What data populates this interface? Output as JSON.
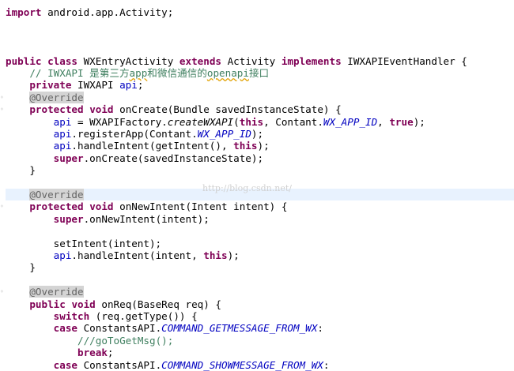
{
  "editor": {
    "lines": [
      [
        {
          "t": "import",
          "c": "kw"
        },
        {
          "t": " android.app.Activity;"
        }
      ],
      [],
      [],
      [],
      [
        {
          "t": "public",
          "c": "kw"
        },
        {
          "t": " "
        },
        {
          "t": "class",
          "c": "kw"
        },
        {
          "t": " WXEntryActivity "
        },
        {
          "t": "extends",
          "c": "kw"
        },
        {
          "t": " Activity "
        },
        {
          "t": "implements",
          "c": "kw"
        },
        {
          "t": " IWXAPIEventHandler {"
        }
      ],
      [
        {
          "t": "    "
        },
        {
          "t": "// IWXAPI 是第三方",
          "c": "cmt"
        },
        {
          "t": "app",
          "c": "cmt squig"
        },
        {
          "t": "和微信通信的",
          "c": "cmt"
        },
        {
          "t": "openapi",
          "c": "cmt squig"
        },
        {
          "t": "接口",
          "c": "cmt"
        }
      ],
      [
        {
          "t": "    "
        },
        {
          "t": "private",
          "c": "kw"
        },
        {
          "t": " IWXAPI "
        },
        {
          "t": "api",
          "c": "field"
        },
        {
          "t": ";"
        }
      ],
      [
        {
          "t": "    "
        },
        {
          "t": "@Override",
          "c": "ann"
        }
      ],
      [
        {
          "t": "    "
        },
        {
          "t": "protected",
          "c": "kw"
        },
        {
          "t": " "
        },
        {
          "t": "void",
          "c": "kw"
        },
        {
          "t": " onCreate(Bundle savedInstanceState) {"
        }
      ],
      [
        {
          "t": "        "
        },
        {
          "t": "api",
          "c": "field"
        },
        {
          "t": " = WXAPIFactory."
        },
        {
          "t": "createWXAPI",
          "c": "smethod"
        },
        {
          "t": "("
        },
        {
          "t": "this",
          "c": "kw"
        },
        {
          "t": ", Contant."
        },
        {
          "t": "WX_APP_ID",
          "c": "sfield"
        },
        {
          "t": ", "
        },
        {
          "t": "true",
          "c": "kw"
        },
        {
          "t": ");"
        }
      ],
      [
        {
          "t": "        "
        },
        {
          "t": "api",
          "c": "field"
        },
        {
          "t": ".registerApp(Contant."
        },
        {
          "t": "WX_APP_ID",
          "c": "sfield"
        },
        {
          "t": ");"
        }
      ],
      [
        {
          "t": "        "
        },
        {
          "t": "api",
          "c": "field"
        },
        {
          "t": ".handleIntent(getIntent(), "
        },
        {
          "t": "this",
          "c": "kw"
        },
        {
          "t": ");"
        }
      ],
      [
        {
          "t": "        "
        },
        {
          "t": "super",
          "c": "kw"
        },
        {
          "t": ".onCreate(savedInstanceState);"
        }
      ],
      [
        {
          "t": "    }"
        }
      ],
      [],
      [
        {
          "t": "    "
        },
        {
          "t": "@Override",
          "c": "ann"
        }
      ],
      [
        {
          "t": "    "
        },
        {
          "t": "protected",
          "c": "kw"
        },
        {
          "t": " "
        },
        {
          "t": "void",
          "c": "kw"
        },
        {
          "t": " onNewIntent(Intent intent) {"
        }
      ],
      [
        {
          "t": "        "
        },
        {
          "t": "super",
          "c": "kw"
        },
        {
          "t": ".onNewIntent(intent);"
        }
      ],
      [],
      [
        {
          "t": "        setIntent(intent);"
        }
      ],
      [
        {
          "t": "        "
        },
        {
          "t": "api",
          "c": "field"
        },
        {
          "t": ".handleIntent(intent, "
        },
        {
          "t": "this",
          "c": "kw"
        },
        {
          "t": ");"
        }
      ],
      [
        {
          "t": "    }"
        }
      ],
      [],
      [
        {
          "t": "    "
        },
        {
          "t": "@Override",
          "c": "ann"
        }
      ],
      [
        {
          "t": "    "
        },
        {
          "t": "public",
          "c": "kw"
        },
        {
          "t": " "
        },
        {
          "t": "void",
          "c": "kw"
        },
        {
          "t": " onReq(BaseReq req) {"
        }
      ],
      [
        {
          "t": "        "
        },
        {
          "t": "switch",
          "c": "kw"
        },
        {
          "t": " (req.getType()) {"
        }
      ],
      [
        {
          "t": "        "
        },
        {
          "t": "case",
          "c": "kw"
        },
        {
          "t": " ConstantsAPI."
        },
        {
          "t": "COMMAND_GETMESSAGE_FROM_WX",
          "c": "sfield"
        },
        {
          "t": ":"
        }
      ],
      [
        {
          "t": "            "
        },
        {
          "t": "///goToGetMsg();",
          "c": "cmt"
        }
      ],
      [
        {
          "t": "            "
        },
        {
          "t": "break",
          "c": "kw"
        },
        {
          "t": ";"
        }
      ],
      [
        {
          "t": "        "
        },
        {
          "t": "case",
          "c": "kw"
        },
        {
          "t": " ConstantsAPI."
        },
        {
          "t": "COMMAND_SHOWMESSAGE_FROM_WX",
          "c": "sfield"
        },
        {
          "t": ":"
        }
      ]
    ],
    "current_line": 15,
    "fold_markers": [
      7,
      8,
      16,
      23
    ],
    "watermark": "http://blog.csdn.net/"
  }
}
